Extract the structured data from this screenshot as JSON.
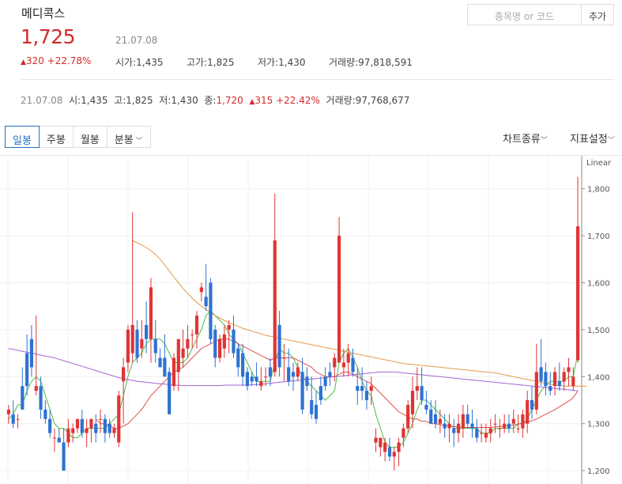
{
  "header": {
    "stock_name": "메디콕스",
    "price": "1,725",
    "date": "21.07.08",
    "change_arrow": "▲",
    "change": "320 +22.78%",
    "open_label": "시가",
    "open": "1,435",
    "high_label": "고가",
    "high": "1,825",
    "low_label": "저가",
    "low": "1,430",
    "volume_label": "거래량",
    "volume": "97,818,591",
    "search_placeholder": "종목명 or 코드",
    "add_label": "추가"
  },
  "detail": {
    "date": "21.07.08",
    "open_label": "시",
    "open": "1,435",
    "high_label": "고",
    "high": "1,825",
    "low_label": "저",
    "low": "1,430",
    "close_label": "종",
    "close": "1,720",
    "change_arrow": "▲",
    "change": "315 +22.42%",
    "volume_label": "거래량",
    "volume": "97,768,677"
  },
  "tabs": {
    "daily": "일봉",
    "weekly": "주봉",
    "monthly": "월봉",
    "minute": "분봉",
    "active": "daily"
  },
  "menu": {
    "chart_type": "차트종류",
    "indicator": "지표설정"
  },
  "icons": {
    "dropdown": "chevron-down-icon",
    "up": "triangle-up-icon"
  },
  "colors": {
    "up": "#e03434",
    "down": "#2e72d2",
    "price_red": "#d12b2b",
    "ma5": "#4cbb4c",
    "ma20": "#e05050",
    "ma60": "#a764d8",
    "ma120": "#e69a4e",
    "tab_active": "#2a6fbf"
  },
  "chart_data": {
    "type": "candlestick",
    "y_scale_label": "Linear",
    "yticks": [
      1200,
      1300,
      1400,
      1500,
      1600,
      1700,
      1800
    ],
    "ylim": [
      1180,
      1860
    ],
    "grid": true,
    "candles": [
      [
        1320,
        1340,
        1300,
        1330
      ],
      [
        1320,
        1350,
        1290,
        1300
      ],
      [
        1310,
        1320,
        1290,
        1310
      ],
      [
        1380,
        1420,
        1330,
        1330
      ],
      [
        1450,
        1490,
        1360,
        1380
      ],
      [
        1480,
        1510,
        1400,
        1420
      ],
      [
        1370,
        1530,
        1360,
        1380
      ],
      [
        1380,
        1400,
        1310,
        1330
      ],
      [
        1330,
        1350,
        1300,
        1310
      ],
      [
        1310,
        1330,
        1270,
        1280
      ],
      [
        1270,
        1290,
        1240,
        1270
      ],
      [
        1270,
        1290,
        1260,
        1260
      ],
      [
        1260,
        1290,
        1200,
        1200
      ],
      [
        1260,
        1310,
        1250,
        1290
      ],
      [
        1280,
        1300,
        1260,
        1290
      ],
      [
        1290,
        1310,
        1280,
        1310
      ],
      [
        1310,
        1330,
        1270,
        1280
      ],
      [
        1280,
        1310,
        1250,
        1290
      ],
      [
        1290,
        1310,
        1260,
        1310
      ],
      [
        1300,
        1320,
        1260,
        1280
      ],
      [
        1310,
        1330,
        1280,
        1310
      ],
      [
        1310,
        1320,
        1260,
        1280
      ],
      [
        1300,
        1310,
        1270,
        1280
      ],
      [
        1280,
        1300,
        1270,
        1290
      ],
      [
        1260,
        1370,
        1250,
        1360
      ],
      [
        1390,
        1440,
        1300,
        1420
      ],
      [
        1430,
        1510,
        1410,
        1500
      ],
      [
        1450,
        1750,
        1430,
        1510
      ],
      [
        1500,
        1520,
        1430,
        1440
      ],
      [
        1460,
        1520,
        1440,
        1480
      ],
      [
        1510,
        1560,
        1450,
        1480
      ],
      [
        1480,
        1610,
        1430,
        1590
      ],
      [
        1480,
        1520,
        1430,
        1450
      ],
      [
        1440,
        1460,
        1420,
        1420
      ],
      [
        1440,
        1490,
        1400,
        1400
      ],
      [
        1410,
        1420,
        1320,
        1320
      ],
      [
        1380,
        1450,
        1370,
        1440
      ],
      [
        1410,
        1480,
        1370,
        1480
      ],
      [
        1440,
        1500,
        1420,
        1460
      ],
      [
        1460,
        1510,
        1440,
        1480
      ],
      [
        1490,
        1500,
        1460,
        1490
      ],
      [
        1490,
        1540,
        1460,
        1530
      ],
      [
        1580,
        1600,
        1560,
        1590
      ],
      [
        1570,
        1640,
        1540,
        1550
      ],
      [
        1600,
        1610,
        1470,
        1480
      ],
      [
        1500,
        1510,
        1420,
        1440
      ],
      [
        1440,
        1490,
        1430,
        1480
      ],
      [
        1460,
        1510,
        1440,
        1490
      ],
      [
        1500,
        1520,
        1450,
        1510
      ],
      [
        1500,
        1530,
        1440,
        1450
      ],
      [
        1460,
        1470,
        1400,
        1420
      ],
      [
        1450,
        1470,
        1380,
        1400
      ],
      [
        1410,
        1420,
        1370,
        1380
      ],
      [
        1400,
        1410,
        1380,
        1390
      ],
      [
        1400,
        1430,
        1380,
        1390
      ],
      [
        1380,
        1420,
        1370,
        1390
      ],
      [
        1400,
        1420,
        1380,
        1400
      ],
      [
        1420,
        1440,
        1380,
        1400
      ],
      [
        1410,
        1790,
        1400,
        1690
      ],
      [
        1510,
        1540,
        1400,
        1420
      ],
      [
        1440,
        1470,
        1390,
        1440
      ],
      [
        1420,
        1460,
        1380,
        1390
      ],
      [
        1410,
        1430,
        1370,
        1400
      ],
      [
        1400,
        1430,
        1390,
        1420
      ],
      [
        1410,
        1440,
        1320,
        1330
      ],
      [
        1400,
        1420,
        1370,
        1380
      ],
      [
        1350,
        1400,
        1310,
        1320
      ],
      [
        1340,
        1370,
        1300,
        1310
      ],
      [
        1380,
        1400,
        1340,
        1350
      ],
      [
        1400,
        1420,
        1370,
        1380
      ],
      [
        1410,
        1430,
        1380,
        1400
      ],
      [
        1420,
        1450,
        1390,
        1440
      ],
      [
        1430,
        1740,
        1430,
        1700
      ],
      [
        1420,
        1460,
        1400,
        1430
      ],
      [
        1430,
        1470,
        1400,
        1450
      ],
      [
        1440,
        1460,
        1400,
        1410
      ],
      [
        1380,
        1420,
        1340,
        1370
      ],
      [
        1380,
        1420,
        1350,
        1370
      ],
      [
        1370,
        1390,
        1330,
        1350
      ],
      [
        1370,
        1400,
        1340,
        1380
      ],
      [
        1260,
        1290,
        1240,
        1270
      ],
      [
        1250,
        1270,
        1230,
        1270
      ],
      [
        1240,
        1270,
        1220,
        1260
      ],
      [
        1250,
        1270,
        1220,
        1230
      ],
      [
        1230,
        1250,
        1200,
        1240
      ],
      [
        1240,
        1270,
        1210,
        1260
      ],
      [
        1270,
        1300,
        1250,
        1290
      ],
      [
        1290,
        1350,
        1280,
        1340
      ],
      [
        1320,
        1400,
        1290,
        1370
      ],
      [
        1370,
        1420,
        1350,
        1380
      ],
      [
        1380,
        1420,
        1340,
        1350
      ],
      [
        1340,
        1370,
        1320,
        1330
      ],
      [
        1330,
        1350,
        1300,
        1300
      ],
      [
        1320,
        1350,
        1290,
        1300
      ],
      [
        1300,
        1330,
        1280,
        1310
      ],
      [
        1300,
        1320,
        1270,
        1290
      ],
      [
        1290,
        1320,
        1260,
        1300
      ],
      [
        1290,
        1310,
        1250,
        1280
      ],
      [
        1280,
        1320,
        1260,
        1300
      ],
      [
        1290,
        1340,
        1270,
        1320
      ],
      [
        1320,
        1340,
        1290,
        1300
      ],
      [
        1300,
        1330,
        1270,
        1290
      ],
      [
        1290,
        1310,
        1260,
        1270
      ],
      [
        1280,
        1300,
        1260,
        1280
      ],
      [
        1270,
        1300,
        1260,
        1280
      ],
      [
        1280,
        1310,
        1260,
        1290
      ],
      [
        1300,
        1320,
        1280,
        1300
      ],
      [
        1290,
        1310,
        1270,
        1290
      ],
      [
        1290,
        1320,
        1280,
        1300
      ],
      [
        1300,
        1320,
        1280,
        1290
      ],
      [
        1300,
        1330,
        1280,
        1310
      ],
      [
        1290,
        1320,
        1280,
        1290
      ],
      [
        1290,
        1330,
        1270,
        1320
      ],
      [
        1300,
        1370,
        1280,
        1350
      ],
      [
        1350,
        1380,
        1310,
        1330
      ],
      [
        1330,
        1470,
        1320,
        1410
      ],
      [
        1420,
        1480,
        1380,
        1390
      ],
      [
        1410,
        1430,
        1360,
        1380
      ],
      [
        1380,
        1410,
        1360,
        1370
      ],
      [
        1380,
        1420,
        1360,
        1410
      ],
      [
        1390,
        1430,
        1370,
        1380
      ],
      [
        1390,
        1420,
        1370,
        1410
      ],
      [
        1410,
        1440,
        1380,
        1420
      ],
      [
        1380,
        1420,
        1370,
        1400
      ],
      [
        1435,
        1825,
        1430,
        1720
      ]
    ],
    "moving_averages": [
      {
        "period": 5,
        "values": [
          1310,
          1320,
          1340,
          1340,
          1370,
          1390,
          1400,
          1390,
          1360,
          1330,
          1300,
          1290,
          1290,
          1280,
          1270,
          1270,
          1280,
          1290,
          1290,
          1290,
          1290,
          1290,
          1300,
          1310,
          1320,
          1360,
          1400,
          1430,
          1440,
          1450,
          1470,
          1480,
          1480,
          1480,
          1470,
          1450,
          1430,
          1430,
          1430,
          1440,
          1460,
          1480,
          1500,
          1530,
          1540,
          1530,
          1520,
          1510,
          1490,
          1480,
          1470,
          1450,
          1430,
          1410,
          1390,
          1390,
          1390,
          1390,
          1430,
          1460,
          1450,
          1450,
          1440,
          1420,
          1400,
          1390,
          1380,
          1370,
          1360,
          1350,
          1360,
          1370,
          1430,
          1450,
          1460,
          1440,
          1420,
          1390,
          1370,
          1360,
          1320,
          1290,
          1260,
          1250,
          1250,
          1250,
          1260,
          1280,
          1300,
          1330,
          1350,
          1350,
          1340,
          1330,
          1320,
          1310,
          1300,
          1290,
          1290,
          1290,
          1290,
          1290,
          1290,
          1280,
          1280,
          1280,
          1290,
          1290,
          1290,
          1290,
          1290,
          1300,
          1300,
          1310,
          1330,
          1350,
          1370,
          1380,
          1390,
          1390,
          1390,
          1390,
          1400,
          1400,
          1450
        ]
      },
      {
        "period": 20,
        "values": [
          null,
          null,
          null,
          null,
          null,
          null,
          null,
          null,
          null,
          null,
          null,
          null,
          null,
          null,
          null,
          null,
          null,
          null,
          null,
          1310,
          1300,
          1300,
          1295,
          1290,
          1290,
          1295,
          1300,
          1310,
          1320,
          1330,
          1345,
          1360,
          1370,
          1380,
          1390,
          1400,
          1410,
          1415,
          1420,
          1430,
          1440,
          1450,
          1460,
          1465,
          1470,
          1475,
          1480,
          1480,
          1480,
          1475,
          1470,
          1465,
          1460,
          1455,
          1450,
          1445,
          1440,
          1435,
          1440,
          1440,
          1440,
          1440,
          1440,
          1435,
          1430,
          1425,
          1420,
          1410,
          1405,
          1400,
          1400,
          1400,
          1405,
          1410,
          1410,
          1405,
          1400,
          1395,
          1390,
          1385,
          1375,
          1365,
          1355,
          1345,
          1335,
          1325,
          1320,
          1315,
          1310,
          1310,
          1305,
          1305,
          1300,
          1300,
          1298,
          1296,
          1295,
          1294,
          1293,
          1292,
          1292,
          1292,
          1292,
          1292,
          1292,
          1292,
          1293,
          1294,
          1295,
          1296,
          1297,
          1299,
          1301,
          1303,
          1306,
          1310,
          1315,
          1320,
          1325,
          1330,
          1336,
          1342,
          1348,
          1355,
          1370
        ]
      },
      {
        "period": 60,
        "values": [
          1460,
          1458,
          1456,
          1454,
          1452,
          1450,
          1448,
          1446,
          1444,
          1442,
          1440,
          1437,
          1434,
          1431,
          1428,
          1425,
          1422,
          1419,
          1416,
          1413,
          1410,
          1407,
          1404,
          1401,
          1398,
          1396,
          1394,
          1392,
          1390,
          1389,
          1388,
          1387,
          1386,
          1385,
          1384,
          1383,
          1382,
          1382,
          1381,
          1381,
          1381,
          1381,
          1381,
          1381,
          1381,
          1381,
          1381,
          1382,
          1382,
          1382,
          1382,
          1382,
          1382,
          1383,
          1383,
          1384,
          1385,
          1386,
          1387,
          1388,
          1389,
          1390,
          1391,
          1392,
          1393,
          1394,
          1395,
          1396,
          1397,
          1398,
          1399,
          1400,
          1401,
          1402,
          1403,
          1404,
          1405,
          1406,
          1407,
          1408,
          1409,
          1410,
          1410,
          1410,
          1410,
          1409,
          1408,
          1407,
          1406,
          1405,
          1404,
          1403,
          1402,
          1401,
          1400,
          1399,
          1398,
          1397,
          1396,
          1395,
          1394,
          1393,
          1392,
          1391,
          1390,
          1389,
          1388,
          1387,
          1386,
          1385,
          1384,
          1383,
          1382,
          1381,
          1380,
          1379,
          1378,
          1377,
          1376,
          1375,
          1374,
          1373,
          1372,
          1371,
          1370
        ]
      },
      {
        "period": 120,
        "values": [
          null,
          null,
          null,
          null,
          null,
          null,
          null,
          null,
          null,
          null,
          null,
          null,
          null,
          null,
          null,
          null,
          null,
          null,
          null,
          null,
          null,
          null,
          null,
          null,
          null,
          null,
          null,
          1690,
          1685,
          1680,
          1675,
          1668,
          1660,
          1650,
          1638,
          1625,
          1612,
          1600,
          1588,
          1577,
          1567,
          1558,
          1550,
          1543,
          1536,
          1530,
          1525,
          1520,
          1515,
          1511,
          1507,
          1503,
          1500,
          1497,
          1494,
          1491,
          1488,
          1486,
          1484,
          1482,
          1480,
          1478,
          1476,
          1474,
          1472,
          1470,
          1468,
          1466,
          1464,
          1462,
          1460,
          1458,
          1456,
          1454,
          1452,
          1450,
          1448,
          1446,
          1444,
          1442,
          1440,
          1438,
          1436,
          1434,
          1432,
          1430,
          1428,
          1427,
          1426,
          1425,
          1424,
          1423,
          1422,
          1421,
          1420,
          1419,
          1418,
          1417,
          1416,
          1415,
          1414,
          1413,
          1412,
          1411,
          1410,
          1409,
          1408,
          1406,
          1404,
          1402,
          1400,
          1398,
          1396,
          1394,
          1392,
          1390,
          1388,
          1386,
          1384,
          1382,
          1381,
          1380,
          1380,
          1380,
          1380,
          1380,
          1380
        ]
      }
    ]
  }
}
